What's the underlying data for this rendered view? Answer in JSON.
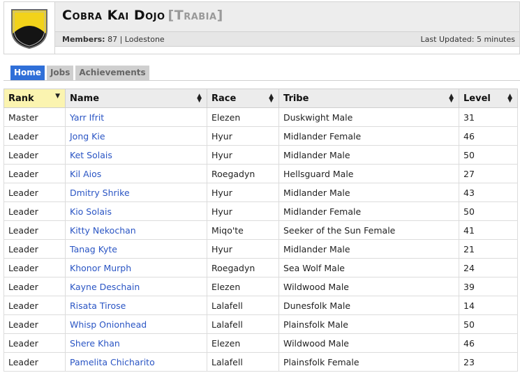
{
  "header": {
    "title": "Cobra Kai Dojo",
    "world": "[Trabia]",
    "members_label": "Members:",
    "members_value": "87 | Lodestone",
    "last_updated": "Last Updated: 5 minutes"
  },
  "tabs": [
    {
      "label": "Home",
      "active": true
    },
    {
      "label": "Jobs",
      "active": false
    },
    {
      "label": "Achievements",
      "active": false
    }
  ],
  "table": {
    "columns": [
      "Rank",
      "Name",
      "Race",
      "Tribe",
      "Level"
    ],
    "rows": [
      {
        "rank": "Master",
        "name": "Yarr Ifrit",
        "race": "Elezen",
        "tribe": "Duskwight Male",
        "level": "31"
      },
      {
        "rank": "Leader",
        "name": "Jong Kie",
        "race": "Hyur",
        "tribe": "Midlander Female",
        "level": "46"
      },
      {
        "rank": "Leader",
        "name": "Ket Solais",
        "race": "Hyur",
        "tribe": "Midlander Male",
        "level": "50"
      },
      {
        "rank": "Leader",
        "name": "Kil Aios",
        "race": "Roegadyn",
        "tribe": "Hellsguard Male",
        "level": "27"
      },
      {
        "rank": "Leader",
        "name": "Dmitry Shrike",
        "race": "Hyur",
        "tribe": "Midlander Male",
        "level": "43"
      },
      {
        "rank": "Leader",
        "name": "Kio Solais",
        "race": "Hyur",
        "tribe": "Midlander Female",
        "level": "50"
      },
      {
        "rank": "Leader",
        "name": "Kitty Nekochan",
        "race": "Miqo'te",
        "tribe": "Seeker of the Sun Female",
        "level": "41"
      },
      {
        "rank": "Leader",
        "name": "Tanag Kyte",
        "race": "Hyur",
        "tribe": "Midlander Male",
        "level": "21"
      },
      {
        "rank": "Leader",
        "name": "Khonor Murph",
        "race": "Roegadyn",
        "tribe": "Sea Wolf Male",
        "level": "24"
      },
      {
        "rank": "Leader",
        "name": "Kayne Deschain",
        "race": "Elezen",
        "tribe": "Wildwood Male",
        "level": "39"
      },
      {
        "rank": "Leader",
        "name": "Risata Tirose",
        "race": "Lalafell",
        "tribe": "Dunesfolk Male",
        "level": "14"
      },
      {
        "rank": "Leader",
        "name": "Whisp Onionhead",
        "race": "Lalafell",
        "tribe": "Plainsfolk Male",
        "level": "50"
      },
      {
        "rank": "Leader",
        "name": "Shere Khan",
        "race": "Elezen",
        "tribe": "Wildwood Male",
        "level": "46"
      },
      {
        "rank": "Leader",
        "name": "Pamelita Chicharito",
        "race": "Lalafell",
        "tribe": "Plainsfolk Female",
        "level": "23"
      }
    ]
  },
  "colors": {
    "accent": "#2f6fd8",
    "link": "#2a55c4",
    "sorted_header": "#fbf4b0",
    "crest_yellow": "#f2d21a",
    "crest_black": "#141414"
  },
  "icons": {
    "crest": "shield-crest-icon",
    "sort_active": "sort-desc-icon",
    "sort_inactive": "sort-both-icon"
  }
}
